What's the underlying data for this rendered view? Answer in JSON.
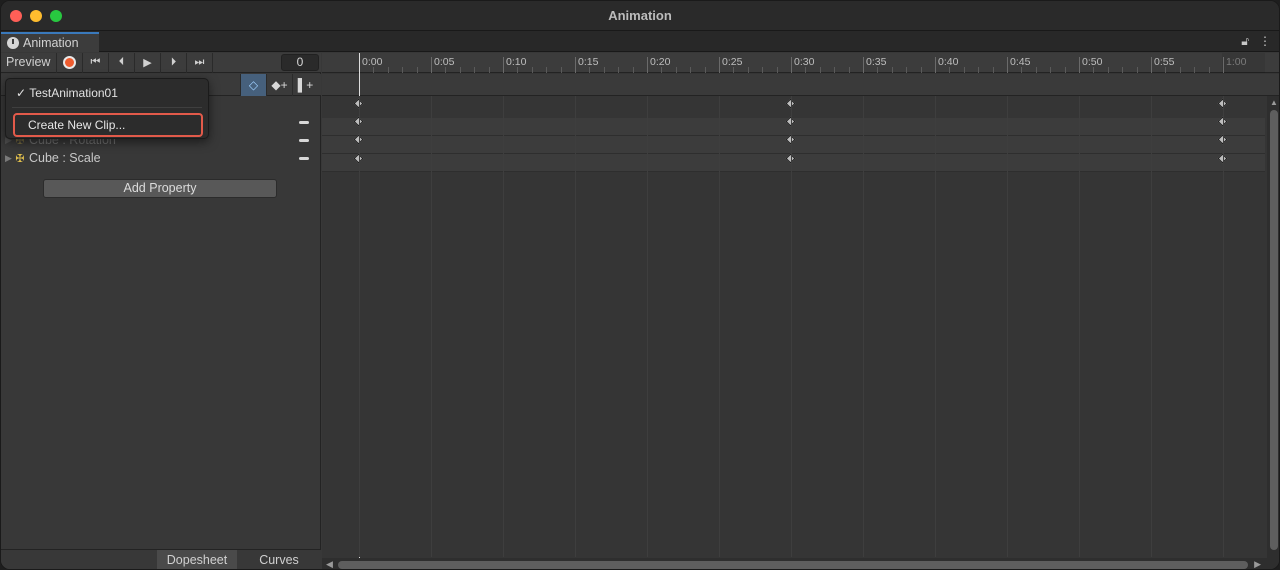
{
  "window": {
    "title": "Animation"
  },
  "tab": {
    "label": "Animation",
    "icon": "clock-icon"
  },
  "controls": {
    "preview_label": "Preview",
    "frame_value": "0",
    "icons": [
      "record-icon",
      "first-key-icon",
      "prev-key-icon",
      "play-icon",
      "next-key-icon",
      "last-key-icon"
    ]
  },
  "toolbar_icons": [
    "filter-keyframes-icon",
    "add-keyframe-icon",
    "add-event-icon"
  ],
  "dropdown": {
    "current_clip": "TestAnimation01",
    "check": "✓",
    "create_new_clip": "Create New Clip..."
  },
  "properties": [
    {
      "label": "Cube : Rotation",
      "faded": true
    },
    {
      "label": "Cube : Scale",
      "faded": false
    }
  ],
  "add_property_label": "Add Property",
  "bottom_tabs": {
    "dopesheet": "Dopesheet",
    "curves": "Curves"
  },
  "timeline": {
    "ticks": [
      "0:00",
      "0:05",
      "0:10",
      "0:15",
      "0:20",
      "0:25",
      "0:30",
      "0:35",
      "0:40",
      "0:45",
      "0:50",
      "0:55",
      "1:00"
    ],
    "keyframe_times": [
      "0:00",
      "0:30",
      "1:00"
    ],
    "key_rows": 4,
    "playhead": "0:00"
  },
  "colors": {
    "accent": "#3a79bb",
    "record": "#ef5c2f",
    "highlight": "#e25a4a"
  }
}
